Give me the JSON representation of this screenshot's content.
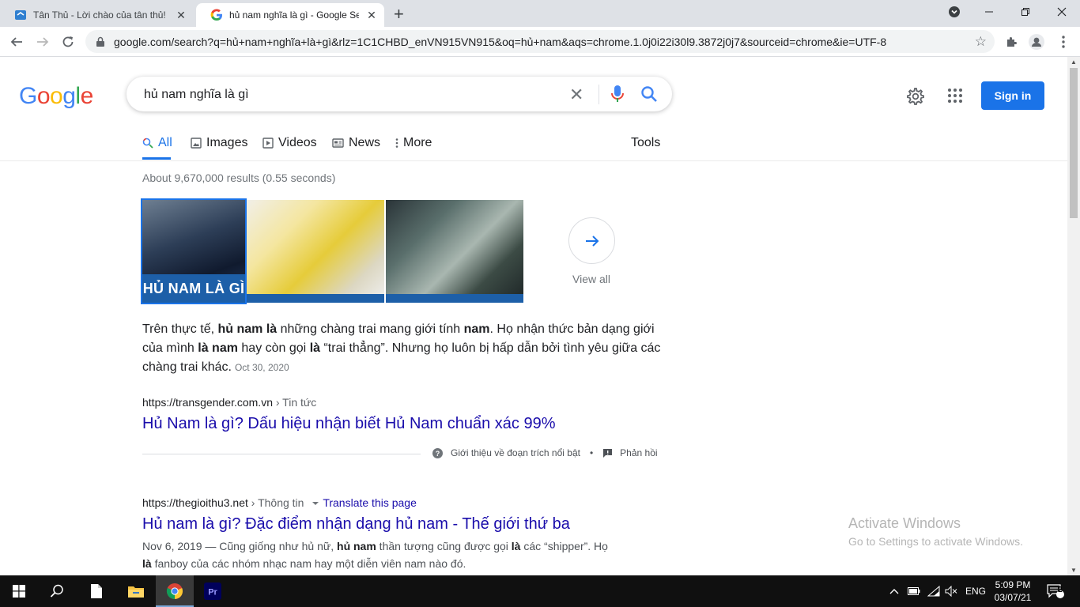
{
  "browser": {
    "tabs": [
      {
        "title": "Tân Thủ - Lời chào của tân thủ! | Ho",
        "close": "✕"
      },
      {
        "title": "hủ nam nghĩa là gì - Google Search",
        "close": "✕"
      }
    ],
    "new_tab": "+",
    "url": "google.com/search?q=hủ+nam+nghĩa+là+gì&rlz=1C1CHBD_enVN915VN915&oq=hủ+nam&aqs=chrome.1.0j0i22i30l9.3872j0j7&sourceid=chrome&ie=UTF-8"
  },
  "google": {
    "logo": [
      "G",
      "o",
      "o",
      "g",
      "l",
      "e"
    ],
    "logo_colors": [
      "#4285f4",
      "#ea4335",
      "#fbbc05",
      "#4285f4",
      "#34a853",
      "#ea4335"
    ],
    "query": "hủ nam nghĩa là gì",
    "signin": "Sign in",
    "tabs": {
      "all": "All",
      "images": "Images",
      "videos": "Videos",
      "news": "News",
      "more": "More",
      "tools": "Tools"
    },
    "stats": "About 9,670,000 results (0.55 seconds)",
    "image_caption": "HỦ NAM LÀ GÌ",
    "view_all": "View all",
    "featured": {
      "s1": "Trên thực tế, ",
      "b1": "hủ nam là",
      "s2": " những chàng trai mang giới tính ",
      "b2": "nam",
      "s3": ". Họ nhận thức bản dạng giới của mình ",
      "b3": "là nam",
      "s4": " hay còn gọi ",
      "b4": "là",
      "s5": " “trai thẳng”. Nhưng họ luôn bị hấp dẫn bởi tình yêu giữa các chàng trai khác.",
      "date": "Oct 30, 2020"
    },
    "result1": {
      "site": "https://transgender.com.vn",
      "crumb": " › Tin tức",
      "title": "Hủ Nam là gì? Dấu hiệu nhận biết Hủ Nam chuẩn xác 99%"
    },
    "feedback": {
      "about": "Giới thiệu về đoạn trích nổi bật",
      "dot": "•",
      "feedback": "Phản hồi"
    },
    "result2": {
      "site": "https://thegioithu3.net",
      "crumb": " › Thông tin",
      "translate": "Translate this page",
      "title": "Hủ nam là gì? Đặc điểm nhận dạng hủ nam - Thế giới thứ ba",
      "date": "Nov 6, 2019",
      "s1": " — Cũng giống như hủ nữ, ",
      "b1": "hủ nam",
      "s2": " thần tượng cũng được gọi ",
      "b2": "là",
      "s3": " các “shipper”. Họ ",
      "b3": "là",
      "s4": " fanboy của các nhóm nhạc nam hay một diễn viên nam nào đó."
    }
  },
  "watermark": {
    "line1": "Activate Windows",
    "line2": "Go to Settings to activate Windows."
  },
  "taskbar": {
    "language": "ENG",
    "time": "5:09 PM",
    "date": "03/07/21",
    "notifications": "2"
  }
}
